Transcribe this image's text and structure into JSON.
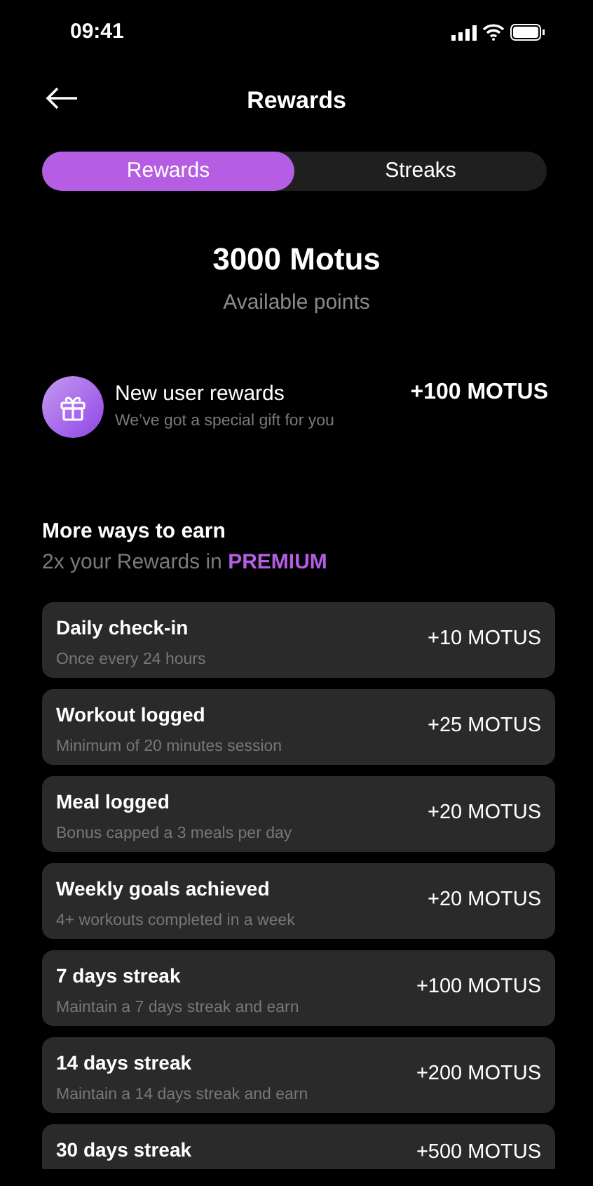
{
  "status_bar": {
    "time": "09:41"
  },
  "header": {
    "title": "Rewards"
  },
  "tabs": [
    {
      "label": "Rewards",
      "selected": true
    },
    {
      "label": "Streaks",
      "selected": false
    }
  ],
  "points": {
    "amount": "3000 Motus",
    "caption": "Available points"
  },
  "new_user": {
    "title": "New user rewards",
    "subtitle": "We’ve got a special gift for you",
    "reward": "+100 MOTUS"
  },
  "more": {
    "title": "More ways to earn",
    "subtitle": "2x your Rewards in **PREMIUM**"
  },
  "earn_items": [
    {
      "title": "Daily check-in",
      "subtitle": "Once every 24 hours",
      "reward": "+10 MOTUS"
    },
    {
      "title": "Workout logged",
      "subtitle": "Minimum of 20 minutes session",
      "reward": "+25 MOTUS"
    },
    {
      "title": "Meal logged",
      "subtitle": "Bonus capped a 3 meals per day",
      "reward": "+20 MOTUS"
    },
    {
      "title": "Weekly goals achieved",
      "subtitle": "4+ workouts completed in a week",
      "reward": "+20 MOTUS"
    },
    {
      "title": "7 days streak",
      "subtitle": "Maintain a 7 days streak and earn",
      "reward": "+100 MOTUS"
    },
    {
      "title": "14 days streak",
      "subtitle": "Maintain a 14 days streak and earn",
      "reward": "+200 MOTUS"
    },
    {
      "title": "30 days streak",
      "reward": "+500 MOTUS"
    }
  ]
}
